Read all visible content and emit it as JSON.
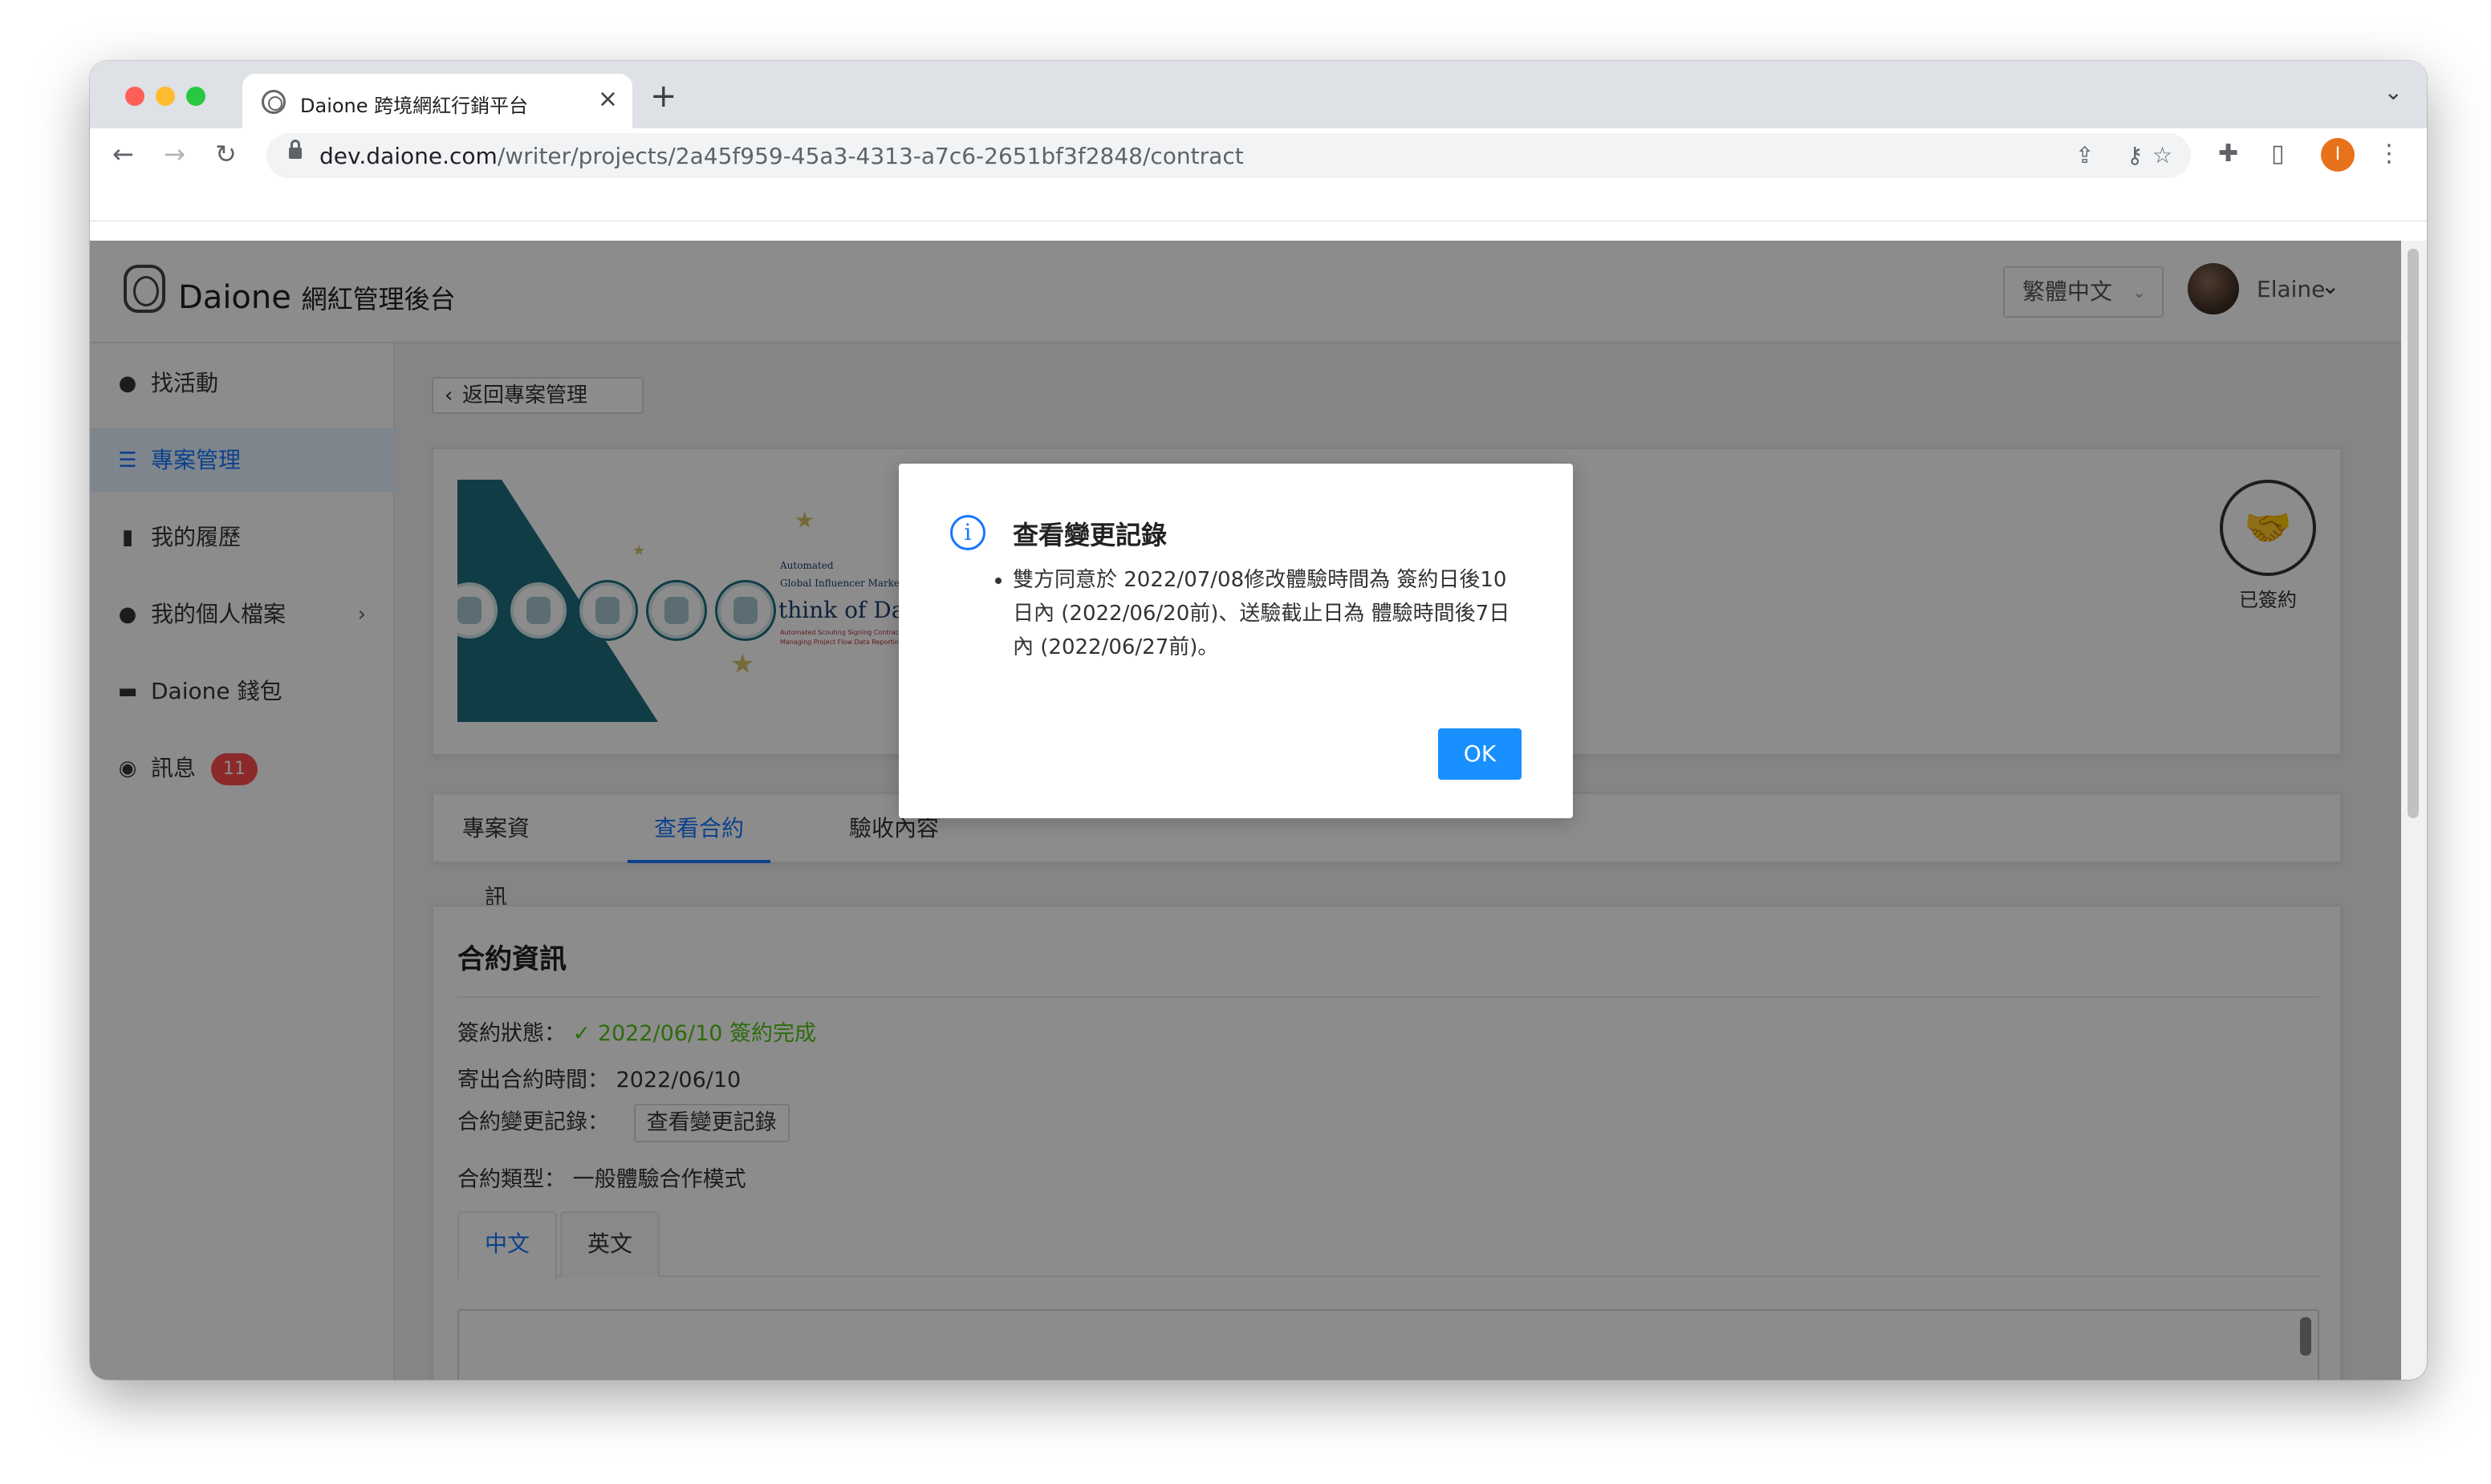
{
  "browser": {
    "tab_title": "Daione 跨境網紅行銷平台",
    "tab_close": "×",
    "new_tab": "+",
    "tab_menu": "⌄",
    "url_host": "dev.daione.com",
    "url_path": "/writer/projects/2a45f959-45a3-4313-a7c6-2651bf3f2848/contract",
    "back": "←",
    "forward": "→",
    "reload": "↻",
    "key_icon": "⚷",
    "share_icon": "⇪",
    "star_icon": "☆",
    "extensions_icon": "✚",
    "sidepanel_icon": "▯",
    "profile_initial": "I",
    "menu_icon": "⋮"
  },
  "header": {
    "brand_name": "Daione",
    "brand_suffix": "網紅管理後台",
    "language": "繁體中文",
    "language_chevron": "⌄",
    "username": "Elaine",
    "user_chevron": "⌄"
  },
  "sidebar": {
    "items": [
      {
        "label": "找活動",
        "icon": "●"
      },
      {
        "label": "專案管理",
        "icon": "☰"
      },
      {
        "label": "我的履歷",
        "icon": "▮"
      },
      {
        "label": "我的個人檔案",
        "icon": "●",
        "arrow": "›"
      },
      {
        "label": "Daione 錢包",
        "icon": "▬"
      },
      {
        "label": "訊息",
        "icon": "◉",
        "badge": "11"
      }
    ]
  },
  "main": {
    "back_label": "返回專案管理",
    "back_chevron": "‹",
    "banner": {
      "small1": "Automated",
      "small2": "Global Influencer Market",
      "title": "think of Daior",
      "tiny1": "Automated Scouting      Signing Contracts O",
      "tiny2": "Managing Project Flow    Data Reporting"
    },
    "signed_icon": "🤝",
    "signed_label": "已簽約",
    "tabs": [
      "專案資訊",
      "查看合約",
      "驗收內容"
    ],
    "contract": {
      "title": "合約資訊",
      "status_label": "簽約狀態：",
      "status_icon": "✓",
      "status_value": "2022/06/10 簽約完成",
      "sent_label": "寄出合約時間：",
      "sent_value": "2022/06/10",
      "change_label": "合約變更記錄：",
      "change_button": "查看變更記錄",
      "type_label": "合約類型：",
      "type_value": "一般體驗合作模式",
      "lang_tabs": [
        "中文",
        "英文"
      ]
    }
  },
  "modal": {
    "icon": "i",
    "title": "查看變更記錄",
    "content": "雙方同意於 2022/07/08修改體驗時間為 簽約日後10日內 (2022/06/20前)、送驗截止日為 體驗時間後7日內 (2022/06/27前)。",
    "ok_label": "OK"
  },
  "colors": {
    "primary": "#1677ff",
    "success": "#52c41a",
    "badge": "#ff4d4f",
    "brand_teal": "#1d6e7e"
  }
}
